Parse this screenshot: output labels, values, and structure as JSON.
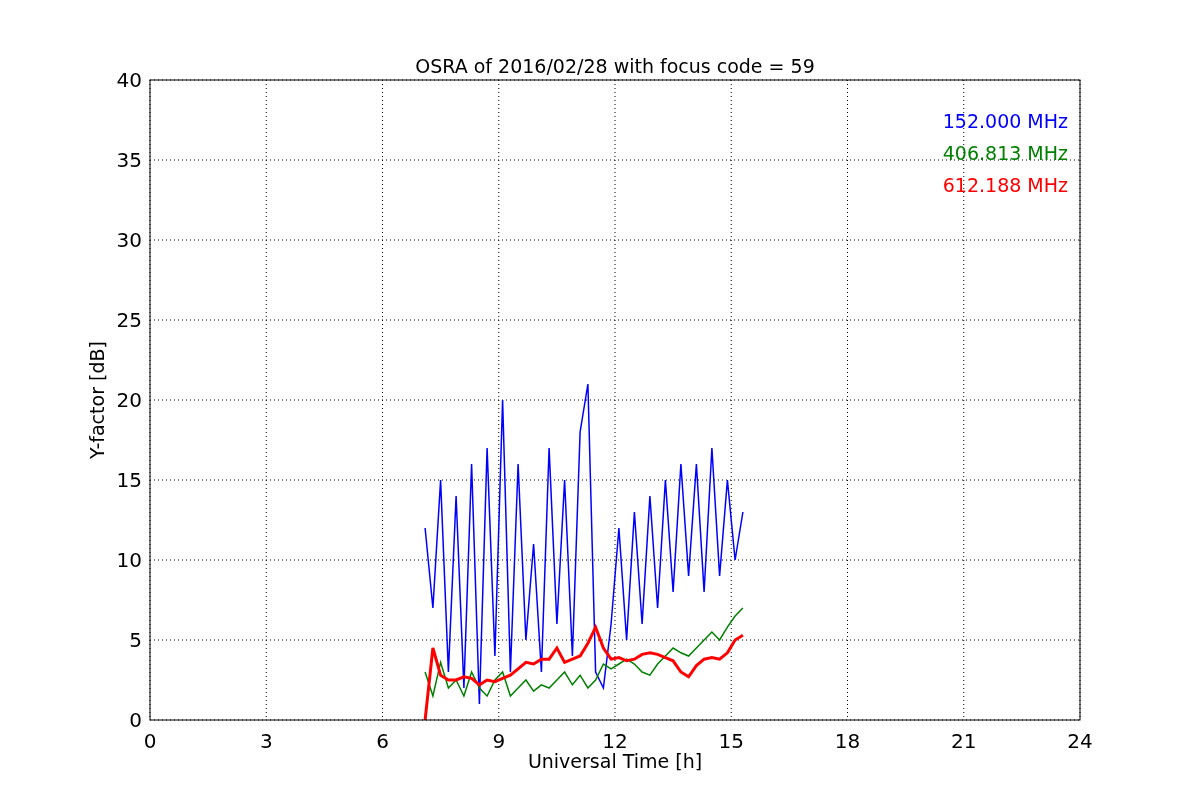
{
  "chart_data": {
    "type": "line",
    "title": "OSRA of 2016/02/28 with focus code = 59",
    "xlabel": "Universal Time [h]",
    "ylabel": "Y-factor [dB]",
    "x": [
      7.1,
      7.3,
      7.5,
      7.7,
      7.9,
      8.1,
      8.3,
      8.5,
      8.7,
      8.9,
      9.1,
      9.3,
      9.5,
      9.7,
      9.9,
      10.1,
      10.3,
      10.5,
      10.7,
      10.9,
      11.1,
      11.3,
      11.5,
      11.7,
      11.9,
      12.1,
      12.3,
      12.5,
      12.7,
      12.9,
      13.1,
      13.3,
      13.5,
      13.7,
      13.9,
      14.1,
      14.3,
      14.5,
      14.7,
      14.9,
      15.1,
      15.3
    ],
    "series": [
      {
        "name": "152.000 MHz",
        "color": "#0000ff",
        "values": [
          12,
          7,
          15,
          3,
          14,
          2,
          16,
          1,
          17,
          4,
          20,
          3,
          16,
          5,
          11,
          3,
          17,
          6,
          15,
          4,
          18,
          21,
          3,
          2,
          6,
          12,
          5,
          13,
          6,
          14,
          7,
          15,
          8,
          16,
          9,
          16,
          8,
          17,
          9,
          15,
          10,
          13
        ]
      },
      {
        "name": "406.813 MHz",
        "color": "#008000",
        "values": [
          3,
          1.5,
          3.6,
          2,
          2.5,
          1.5,
          3,
          2,
          1.5,
          2.5,
          3,
          1.5,
          2,
          2.5,
          1.8,
          2.2,
          2,
          2.5,
          3,
          2.2,
          2.8,
          2,
          2.5,
          3.5,
          3.2,
          3.5,
          3.8,
          3.5,
          3,
          2.8,
          3.5,
          4,
          4.5,
          4.2,
          4,
          4.5,
          5,
          5.5,
          5,
          5.8,
          6.5,
          7
        ]
      },
      {
        "name": "612.188 MHz",
        "color": "#ff0000",
        "values": [
          0,
          4.5,
          2.8,
          2.5,
          2.5,
          2.7,
          2.6,
          2.2,
          2.5,
          2.4,
          2.6,
          2.8,
          3.2,
          3.6,
          3.5,
          3.8,
          3.8,
          4.5,
          3.6,
          3.8,
          4,
          4.8,
          5.8,
          4.5,
          3.8,
          3.9,
          3.7,
          3.8,
          4.1,
          4.2,
          4.1,
          3.9,
          3.7,
          3,
          2.7,
          3.4,
          3.8,
          3.9,
          3.8,
          4.2,
          5,
          5.3
        ]
      }
    ],
    "xlim": [
      0,
      24
    ],
    "ylim": [
      0,
      40
    ],
    "xticks": [
      0,
      3,
      6,
      9,
      12,
      15,
      18,
      21,
      24
    ],
    "yticks": [
      0,
      5,
      10,
      15,
      20,
      25,
      30,
      35,
      40
    ],
    "grid": true
  }
}
